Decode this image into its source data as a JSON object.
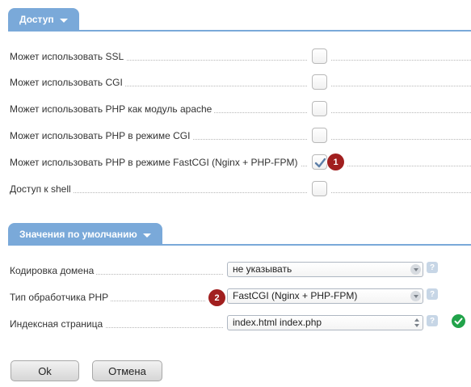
{
  "access_section": {
    "title": "Доступ",
    "rows": [
      {
        "label": "Может использовать SSL",
        "checked": false
      },
      {
        "label": "Может использовать CGI",
        "checked": false
      },
      {
        "label": "Может использовать PHP как модуль apache",
        "checked": false
      },
      {
        "label": "Может использовать PHP в режиме CGI",
        "checked": false
      },
      {
        "label": "Может использовать PHP в режиме FastCGI (Nginx + PHP-FPM)",
        "checked": true
      },
      {
        "label": "Доступ к shell",
        "checked": false
      }
    ],
    "badge": "1"
  },
  "defaults_section": {
    "title": "Значения по умолчанию",
    "domain_encoding": {
      "label": "Кодировка домена",
      "value": "не указывать"
    },
    "php_handler": {
      "label": "Тип обработчика PHP",
      "value": "FastCGI (Nginx + PHP-FPM)",
      "badge": "2"
    },
    "index_page": {
      "label": "Индексная страница",
      "value": "index.html index.php"
    },
    "help_glyph": "?"
  },
  "buttons": {
    "ok": "Ok",
    "cancel": "Отмена"
  },
  "icons": {
    "caret": "caret-down-icon",
    "checkbox_check": "checkmark-icon",
    "help": "help-icon",
    "valid": "check-circle-icon"
  },
  "colors": {
    "accent": "#7aa9d9",
    "badge": "#a11f1f",
    "valid": "#21a34a",
    "help": "#c7d6e6"
  }
}
